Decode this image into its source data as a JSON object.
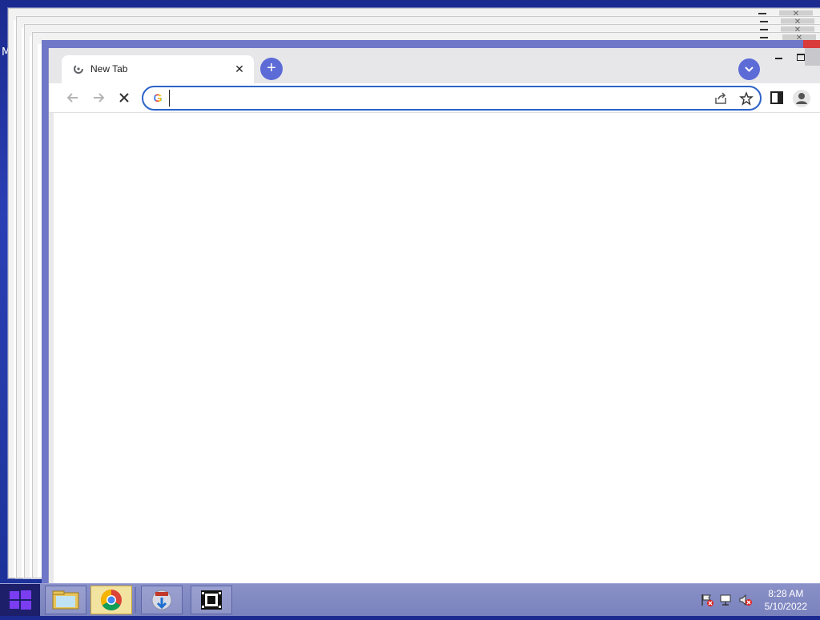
{
  "desktop": {
    "partial_label": "M"
  },
  "browser": {
    "tab": {
      "title": "New Tab",
      "close_glyph": "✕"
    },
    "new_tab_glyph": "+",
    "toolbar": {
      "back_icon": "arrow-left-icon",
      "forward_icon": "arrow-right-icon",
      "stop_icon": "close-icon",
      "omnibox": {
        "value": "",
        "placeholder": ""
      }
    }
  },
  "taskbar": {
    "apps": [
      "file-explorer",
      "google-chrome",
      "app-installer",
      "media-player"
    ],
    "clock": {
      "time": "8:28 AM",
      "date": "5/10/2022"
    }
  },
  "colors": {
    "accent": "#5c6bd6",
    "omnibox_border": "#2d64c9",
    "taskbar": "#7a82bd",
    "desktop": "#2a3fb4"
  }
}
